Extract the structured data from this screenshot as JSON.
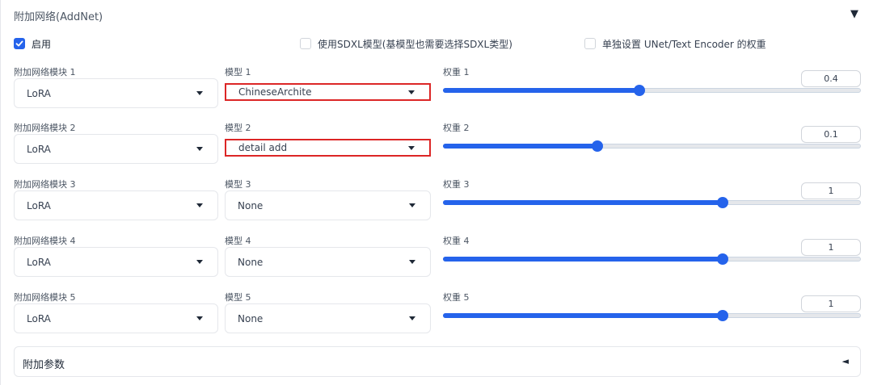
{
  "panel": {
    "title": "附加网络(AddNet)",
    "collapse_icon": "▼"
  },
  "options": {
    "enable_label": "启用",
    "enable_checked": true,
    "sdxl_label": "使用SDXL模型(基模型也需要选择SDXL类型)",
    "sdxl_checked": false,
    "unet_label": "单独设置 UNet/Text Encoder 的权重",
    "unet_checked": false
  },
  "rows": [
    {
      "module_label": "附加网络模块 1",
      "module_value": "LoRA",
      "model_label": "模型 1",
      "model_value": "ChineseArchite",
      "model_highlighted": true,
      "weight_label": "权重 1",
      "weight_value": "0.4",
      "weight_fraction": 0.47
    },
    {
      "module_label": "附加网络模块 2",
      "module_value": "LoRA",
      "model_label": "模型 2",
      "model_value": "detail add",
      "model_highlighted": true,
      "weight_label": "权重 2",
      "weight_value": "0.1",
      "weight_fraction": 0.37
    },
    {
      "module_label": "附加网络模块 3",
      "module_value": "LoRA",
      "model_label": "模型 3",
      "model_value": "None",
      "model_highlighted": false,
      "weight_label": "权重 3",
      "weight_value": "1",
      "weight_fraction": 0.67
    },
    {
      "module_label": "附加网络模块 4",
      "module_value": "LoRA",
      "model_label": "模型 4",
      "model_value": "None",
      "model_highlighted": false,
      "weight_label": "权重 4",
      "weight_value": "1",
      "weight_fraction": 0.67
    },
    {
      "module_label": "附加网络模块 5",
      "module_value": "LoRA",
      "model_label": "模型 5",
      "model_value": "None",
      "model_highlighted": false,
      "weight_label": "权重 5",
      "weight_value": "1",
      "weight_fraction": 0.67
    }
  ],
  "extra": {
    "title": "附加参数",
    "arrow": "◄"
  },
  "colors": {
    "accent": "#2563eb",
    "highlight": "#dc2626"
  }
}
